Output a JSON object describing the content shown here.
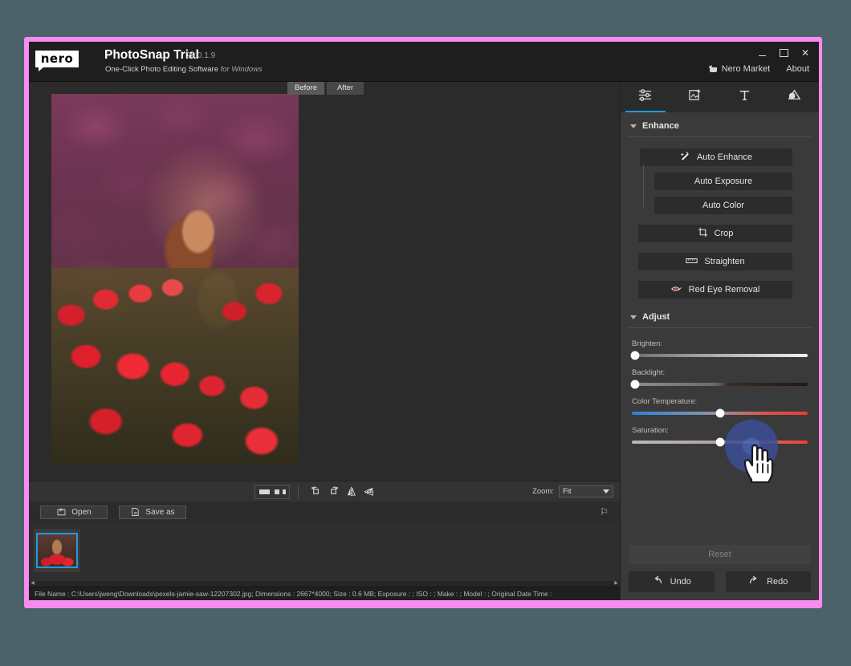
{
  "window": {
    "logo_text": "nero",
    "title": "PhotoSnap Trial",
    "version": "26.0.1.9",
    "subtitle_main": "One-Click Photo Editing Software",
    "subtitle_italic": "for Windows",
    "minimize_label": "—",
    "maximize_label": "□",
    "close_label": "✕",
    "menu": {
      "market": "Nero Market",
      "about": "About"
    }
  },
  "editor": {
    "before_after": {
      "before": "Before",
      "after": "After",
      "active": "Before"
    },
    "toolbar": {
      "view_single": "single-view",
      "view_dual": "dual-view",
      "rotate_left": "↺",
      "rotate_right": "↻",
      "flip_horizontal": "◁▷",
      "flip_vertical": "▷",
      "zoom_label": "Zoom:",
      "zoom_value": "Fit"
    },
    "file_actions": {
      "open": "Open",
      "save_as": "Save as",
      "pin": "⚐"
    },
    "filmstrip": {
      "scroll_left": "◀",
      "scroll_right": "▶"
    },
    "status": "File Name : C:\\Users\\jweng\\Downloads\\pexels-jamie-saw-12207302.jpg; Dimensions : 2667*4000; Size : 0.6 MB; Exposure : ; ISO : ; Make : ; Model : ; Original Date Time :"
  },
  "panel": {
    "tabs": [
      {
        "name": "adjust-tab",
        "icon": "sliders-icon",
        "active": true
      },
      {
        "name": "effects-tab",
        "icon": "image-sparkle-icon",
        "active": false
      },
      {
        "name": "text-tab",
        "icon": "text-icon",
        "active": false
      },
      {
        "name": "mask-tab",
        "icon": "mask-shape-icon",
        "active": false
      }
    ],
    "enhance": {
      "title": "Enhance",
      "auto_enhance": "Auto Enhance",
      "auto_exposure": "Auto Exposure",
      "auto_color": "Auto Color",
      "crop": "Crop",
      "straighten": "Straighten",
      "red_eye": "Red Eye Removal"
    },
    "adjust": {
      "title": "Adjust",
      "sliders": [
        {
          "label": "Brighten:",
          "value_pct": 2,
          "track": "brighten"
        },
        {
          "label": "Backlight:",
          "value_pct": 2,
          "track": "backlight"
        },
        {
          "label": "Color Temperature:",
          "value_pct": 50,
          "track": "temp"
        },
        {
          "label": "Saturation:",
          "value_pct": 50,
          "track": "sat"
        }
      ]
    },
    "footer": {
      "reset": "Reset",
      "undo": "Undo",
      "redo": "Redo"
    }
  },
  "colors": {
    "accent_blue": "#1b9ae0",
    "highlight_pink": "#f78bf0",
    "desktop": "#4b6269",
    "panel_bg": "#3a3a3a",
    "window_bg": "#2b2b2b",
    "cursor_ring": "#3a4f96"
  }
}
